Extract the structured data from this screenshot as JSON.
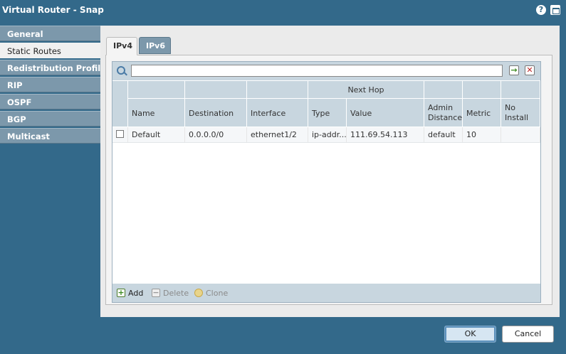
{
  "window": {
    "title": "Virtual Router - Snap"
  },
  "sidebar": {
    "items": [
      {
        "label": "General"
      },
      {
        "label": "Static Routes"
      },
      {
        "label": "Redistribution Profiles"
      },
      {
        "label": "RIP"
      },
      {
        "label": "OSPF"
      },
      {
        "label": "BGP"
      },
      {
        "label": "Multicast"
      }
    ],
    "active": "Static Routes"
  },
  "tabs": [
    {
      "label": "IPv4"
    },
    {
      "label": "IPv6"
    }
  ],
  "search": {
    "value": "",
    "placeholder": ""
  },
  "table": {
    "group_header": "Next Hop",
    "headers": {
      "name": "Name",
      "destination": "Destination",
      "interface": "Interface",
      "type": "Type",
      "value": "Value",
      "admin_distance": "Admin Distance",
      "metric": "Metric",
      "no_install": "No Install"
    },
    "rows": [
      {
        "name": "Default",
        "destination": "0.0.0.0/0",
        "interface": "ethernet1/2",
        "type": "ip-addr...",
        "value": "111.69.54.113",
        "admin_distance": "default",
        "metric": "10",
        "no_install": ""
      }
    ]
  },
  "footer": {
    "add": "Add",
    "delete": "Delete",
    "clone": "Clone"
  },
  "dialog": {
    "ok": "OK",
    "cancel": "Cancel"
  },
  "icons": {
    "help": "help-icon",
    "maximize": "maximize-icon",
    "search": "search-icon",
    "go": "arrow-right-icon",
    "clear": "close-icon"
  }
}
